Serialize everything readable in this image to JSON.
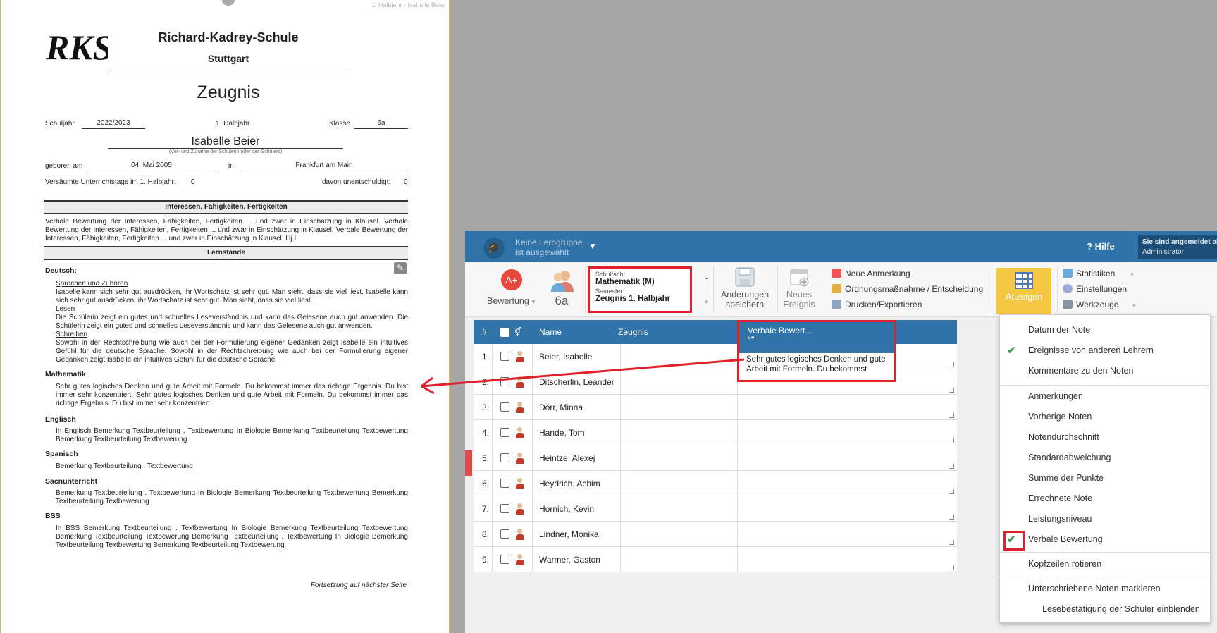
{
  "doc": {
    "header_right": "1. Halbjahr · Isabelle Beier",
    "logo_text": "RKS",
    "school_name": "Richard-Kadrey-Schule",
    "city": "Stuttgart",
    "title": "Zeugnis",
    "schuljahr_label": "Schuljahr",
    "schuljahr_value": "2022/2023",
    "halbjahr": "1. Halbjahr",
    "klasse_label": "Klasse",
    "klasse_value": "6a",
    "student_name": "Isabelle Beier",
    "name_caption": "(Vor- und Zuname der Schülerin oder des Schülers)",
    "born_label": "geboren am",
    "born_value": "04. Mai 2005",
    "in_label": "in",
    "birthplace": "Frankfurt am Main",
    "missed_days": "Versäumte Unterrichtstage im 1. Halbjahr:",
    "missed_value": "0",
    "unexcused": "davon unentschuldigt:",
    "unexcused_value": "0",
    "section_interests": "Interessen, Fähigkeiten, Fertigkeiten",
    "interests_text": "Verbale Bewertung der Interessen, Fähigkeiten, Fertigkeiten ... und zwar in Einschätzung in Klausel. Verbale Bewertung der Interessen, Fähigkeiten, Fertigkeiten ... und zwar in Einschätzung in Klausel. Verbale Bewertung der Interessen, Fähigkeiten, Fertigkeiten ... und zwar in Einschätzung in Klausel. Hj.I",
    "section_lernstaende": "Lernstände",
    "deutsch_label": "Deutsch:",
    "deutsch_sub1": "Sprechen und Zuhören",
    "deutsch_text1": "Isabelle kann sich sehr gut ausdrücken, ihr Wortschatz ist sehr gut. Man sieht, dass sie viel liest. Isabelle kann sich sehr gut ausdrücken, ihr Wortschatz ist sehr gut. Man sieht, dass sie viel liest.",
    "deutsch_sub2": "Lesen",
    "deutsch_text2": "Die Schülerin zeigt ein gutes und schnelles Leseverständnis und kann das Gelesene auch gut anwenden. Die Schülerin zeigt ein gutes und schnelles Leseverständnis und kann das Gelesene auch gut anwenden.",
    "deutsch_sub3": "Schreiben",
    "deutsch_text3": "Sowohl in der Rechtschreibung wie auch bei der Formulierung eigener Gedanken zeigt Isabelle ein intuitives Gefühl für die deutsche Sprache. Sowohl in der Rechtschreibung wie auch bei der Formulierung eigener Gedanken zeigt Isabelle ein intuitives Gefühl für die deutsche Sprache.",
    "mathe_label": "Mathematik",
    "mathe_text": "Sehr gutes logisches Denken und gute Arbeit mit Formeln. Du bekommst immer das richtige Ergebnis. Du bist immer sehr konzentriert. Sehr gutes logisches Denken und gute Arbeit mit Formeln. Du bekommst immer das richtige Ergebnis. Du bist immer sehr konzentriert.",
    "englisch_label": "Englisch",
    "englisch_text": "In Englisch Bemerkung Textbeurteilung . Textbewertung In Biologie Bemerkung Textbeurteilung Textbewertung Bemerkung Textbeurteilung Textbewerung",
    "spanisch_label": "Spanisch",
    "spanisch_text": "Bemerkung Textbeurteilung . Textbewertung",
    "sach_label": "Sacnunterricht",
    "sach_text": "Bemerkung Textbeurteilung . Textbewertung In Biologie Bemerkung Textbeurteilung Textbewertung Bemerkung Textbeurteilung Textbewerung",
    "bss_label": "BSS",
    "bss_text": "In BSS Bemerkung Textbeurteilung . Textbewertung In Biologie Bemerkung Textbeurteilung Textbewertung Bemerkung Textbeurteilung Textbewerung Bemerkung Textbeurteilung . Textbewertung In Biologie Bemerkung Textbeurteilung Textbewertung Bemerkung Textbeurteilung Textbewerung",
    "continued": "Fortsetzung auf nächster Seite"
  },
  "app": {
    "group_line1": "Keine Lerngruppe",
    "group_line2": "ist ausgewählt",
    "help": "Hilfe",
    "user_line1": "Sie sind angemeldet als",
    "user_line2": "Administrator",
    "ribbon": {
      "bewertung": "Bewertung",
      "class": "6a",
      "schulfach_label": "Schulfach:",
      "schulfach_value": "Mathematik (M)",
      "semester_label": "Semester:",
      "semester_value": "Zeugnis 1. Halbjahr",
      "save_line1": "Änderungen",
      "save_line2": "speichern",
      "new_event_line1": "Neues",
      "new_event_line2": "Ereignis",
      "new_note": "Neue Anmerkung",
      "measure": "Ordnungsmaßnahme / Entscheidung",
      "print": "Drucken/Exportieren",
      "anzeigen": "Anzeigen",
      "statistiken": "Statistiken",
      "einstellungen": "Einstellungen",
      "werkzeuge": "Werkzeuge"
    },
    "table": {
      "col_num": "#",
      "col_name": "Name",
      "col_zeugnis": "Zeugnis",
      "col_verbal": "Verbale Bewert...",
      "verbal_text": "Sehr gutes logisches Denken und gute Arbeit mit Formeln. Du bekommst",
      "rows": [
        {
          "num": "1.",
          "name": "Beier, Isabelle"
        },
        {
          "num": "2.",
          "name": "Ditscherlin, Leander"
        },
        {
          "num": "3.",
          "name": "Dörr, Minna"
        },
        {
          "num": "4.",
          "name": "Hande, Tom"
        },
        {
          "num": "5.",
          "name": "Heintze, Alexej"
        },
        {
          "num": "6.",
          "name": "Heydrich, Achim"
        },
        {
          "num": "7.",
          "name": "Hornich, Kevin"
        },
        {
          "num": "8.",
          "name": "Lindner, Monika"
        },
        {
          "num": "9.",
          "name": "Warmer, Gaston"
        }
      ]
    },
    "menu": [
      {
        "label": "Datum der Note",
        "checked": false
      },
      {
        "label": "Ereignisse von anderen Lehrern",
        "checked": true
      },
      {
        "label": "Kommentare zu den Noten",
        "checked": false
      },
      {
        "label": "Anmerkungen",
        "checked": false
      },
      {
        "label": "Vorherige Noten",
        "checked": false
      },
      {
        "label": "Notendurchschnitt",
        "checked": false
      },
      {
        "label": "Standardabweichung",
        "checked": false
      },
      {
        "label": "Summe der Punkte",
        "checked": false
      },
      {
        "label": "Errechnete Note",
        "checked": false
      },
      {
        "label": "Leistungsniveau",
        "checked": false
      },
      {
        "label": "Verbale Bewertung",
        "checked": true
      },
      {
        "label": "Kopfzeilen rotieren",
        "checked": false
      },
      {
        "label": "Unterschriebene Noten markieren",
        "checked": false
      },
      {
        "label": "Lesebestätigung der Schüler einblenden",
        "checked": false
      }
    ],
    "colors": {
      "accent": "#2f73a8",
      "highlight": "#e0212b",
      "anzeigen": "#f4c842"
    }
  }
}
